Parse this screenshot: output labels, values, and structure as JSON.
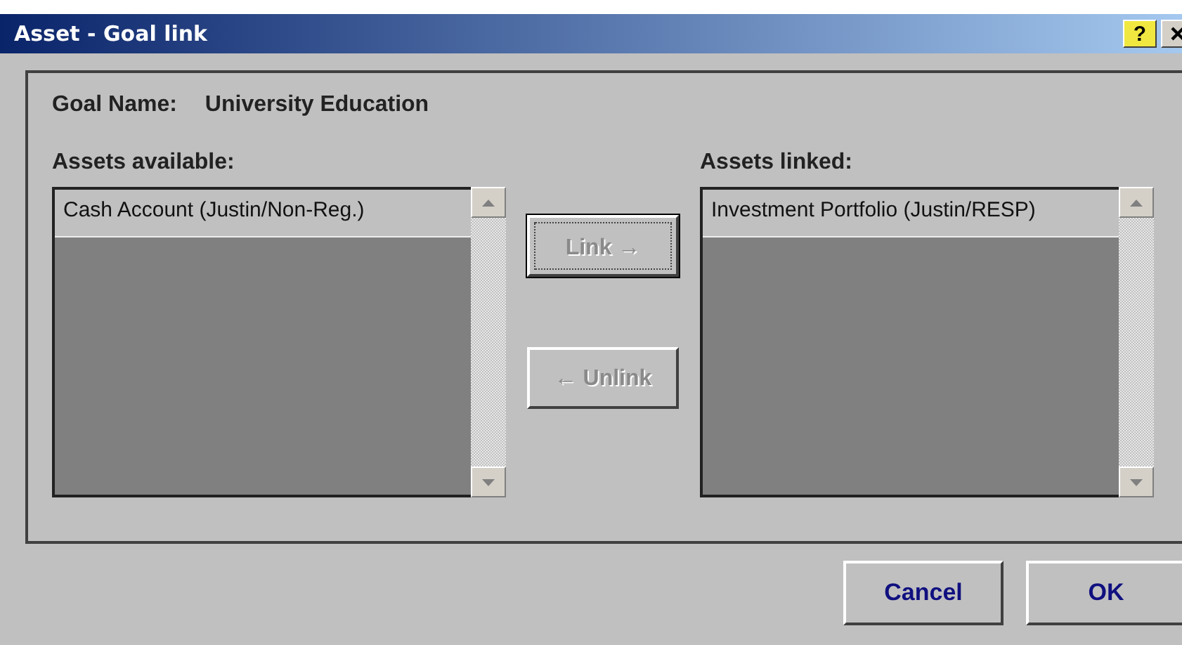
{
  "window": {
    "title": "Asset - Goal link",
    "help_button": "?"
  },
  "goal": {
    "label": "Goal Name:",
    "value": "University Education"
  },
  "available": {
    "label": "Assets available:",
    "items": [
      "Cash Account (Justin/Non-Reg.)"
    ]
  },
  "link_buttons": [
    {
      "label": "Link →",
      "disabled": true,
      "focused": true
    },
    {
      "label": "← Unlink",
      "disabled": true,
      "focused": false
    }
  ],
  "linked": {
    "label": "Assets linked:",
    "items": [
      "Investment Portfolio (Justin/RESP)"
    ]
  },
  "buttons": [
    "Cancel",
    "OK"
  ]
}
